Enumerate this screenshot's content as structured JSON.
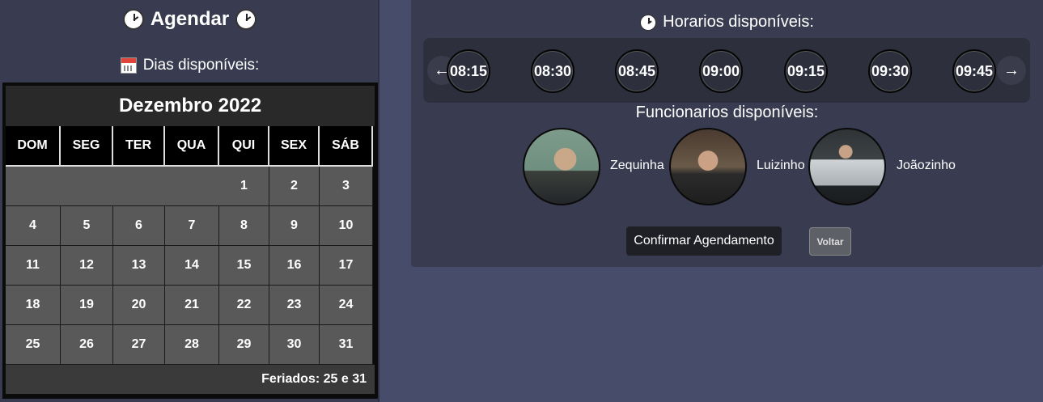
{
  "left": {
    "title": "Agendar",
    "subtitle": "Dias disponíveis:",
    "calendar": {
      "month_label": "Dezembro 2022",
      "weekdays": [
        "DOM",
        "SEG",
        "TER",
        "QUA",
        "QUI",
        "SEX",
        "SÁB"
      ],
      "leading_blanks": 4,
      "days": [
        "1",
        "2",
        "3",
        "4",
        "5",
        "6",
        "7",
        "8",
        "9",
        "10",
        "11",
        "12",
        "13",
        "14",
        "15",
        "16",
        "17",
        "18",
        "19",
        "20",
        "21",
        "22",
        "23",
        "24",
        "25",
        "26",
        "27",
        "28",
        "29",
        "30",
        "31"
      ],
      "footer": "Feriados: 25 e 31"
    }
  },
  "right": {
    "times_title": "Horarios disponíveis:",
    "times": [
      "08:15",
      "08:30",
      "08:45",
      "09:00",
      "09:15",
      "09:30",
      "09:45"
    ],
    "prev_arrow": "←",
    "next_arrow": "→",
    "workers_title": "Funcionarios disponíveis:",
    "workers": [
      {
        "name": "Zequinha"
      },
      {
        "name": "Luizinho"
      },
      {
        "name": "Joãozinho"
      }
    ],
    "confirm_label": "Confirmar Agendamento",
    "back_label": "Voltar"
  },
  "colors": {
    "page_bg": "#474c6b",
    "panel_bg": "#393c50",
    "day_cell": "#595959",
    "calendar_header": "#292929"
  }
}
